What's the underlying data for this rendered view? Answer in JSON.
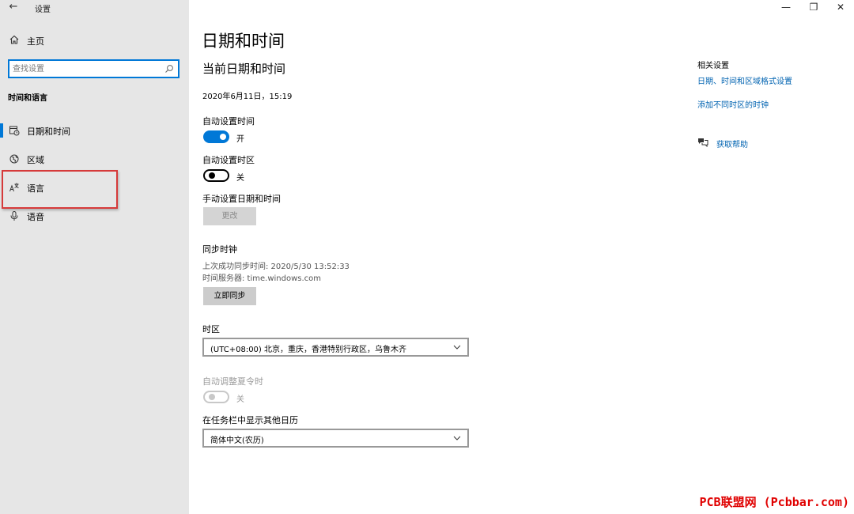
{
  "window": {
    "title": "设置",
    "back_glyph": "←",
    "minimize_glyph": "—",
    "restore_glyph": "❐",
    "close_glyph": "✕"
  },
  "sidebar": {
    "home_label": "主页",
    "search_placeholder": "查找设置",
    "section_title": "时间和语言",
    "items": [
      {
        "label": "日期和时间",
        "icon": "calendar-clock-icon",
        "active": true
      },
      {
        "label": "区域",
        "icon": "globe-region-icon",
        "active": false
      },
      {
        "label": "语言",
        "icon": "language-icon",
        "active": false
      },
      {
        "label": "语音",
        "icon": "microphone-icon",
        "active": false
      }
    ]
  },
  "main": {
    "page_title": "日期和时间",
    "subtitle": "当前日期和时间",
    "current_datetime": "2020年6月11日，15:19",
    "auto_time": {
      "label": "自动设置时间",
      "state_label": "开",
      "on": true
    },
    "auto_timezone": {
      "label": "自动设置时区",
      "state_label": "关",
      "on": false
    },
    "manual": {
      "label": "手动设置日期和时间",
      "button_label": "更改"
    },
    "sync": {
      "title": "同步时钟",
      "last_sync": "上次成功同步时间: 2020/5/30 13:52:33",
      "server": "时间服务器: time.windows.com",
      "button_label": "立即同步"
    },
    "timezone": {
      "label": "时区",
      "value": "(UTC+08:00) 北京，重庆，香港特别行政区，乌鲁木齐"
    },
    "dst": {
      "label": "自动调整夏令时",
      "state_label": "关",
      "on": false,
      "disabled": true
    },
    "calendar": {
      "label": "在任务栏中显示其他日历",
      "value": "简体中文(农历)"
    }
  },
  "related": {
    "title": "相关设置",
    "links": [
      "日期、时间和区域格式设置",
      "添加不同时区的时钟"
    ],
    "help_label": "获取帮助"
  },
  "watermark": "PCB联盟网 (Pcbbar.com)",
  "colors": {
    "accent": "#0078d7",
    "link": "#0063b1",
    "sidebar_bg": "#e6e6e6",
    "highlight": "#d63a3a"
  }
}
